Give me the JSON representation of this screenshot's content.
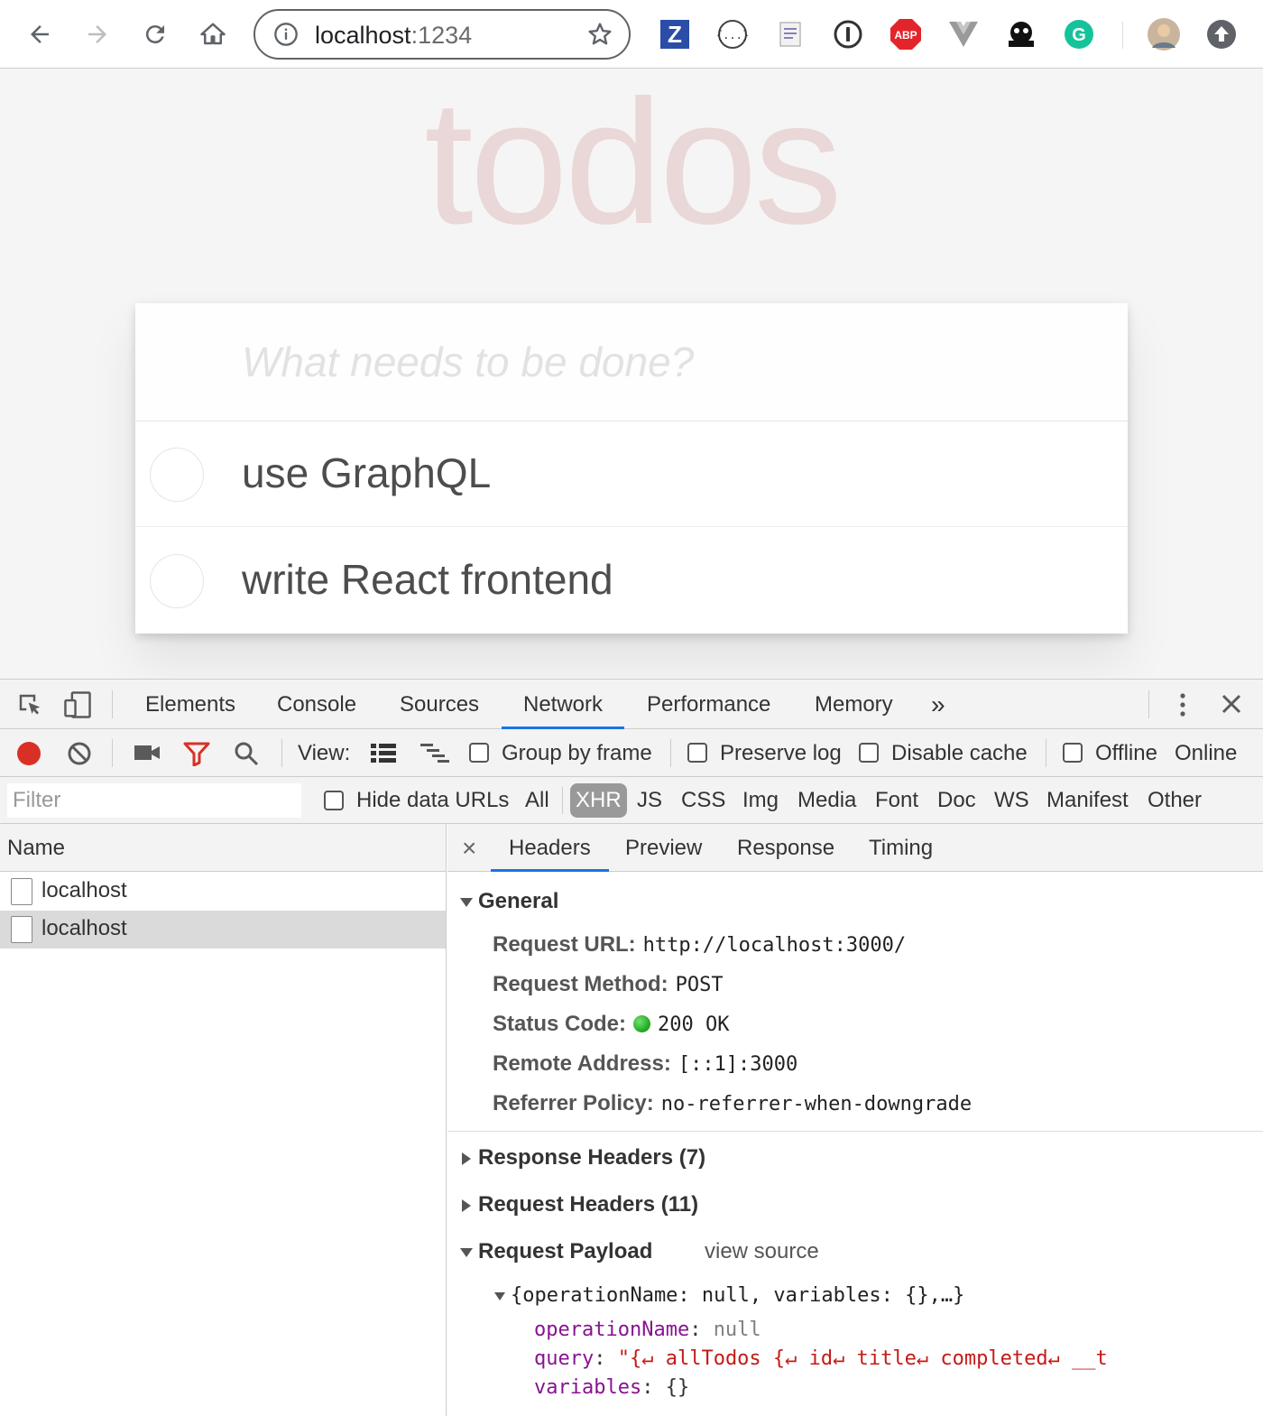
{
  "browser": {
    "url_host": "localhost",
    "url_port": ":1234",
    "extensions": [
      "zotero-icon",
      "json-formatter-icon",
      "notes-icon",
      "1password-icon",
      "adblock-plus-icon",
      "vue-devtools-icon",
      "kuker-icon",
      "grammarly-icon"
    ],
    "adblock_label": "ABP",
    "zotero_label": "Z"
  },
  "todo": {
    "title": "todos",
    "new_placeholder": "What needs to be done?",
    "items": [
      {
        "label": "use GraphQL",
        "completed": false
      },
      {
        "label": "write React frontend",
        "completed": false
      }
    ]
  },
  "devtools": {
    "tabs": [
      "Elements",
      "Console",
      "Sources",
      "Network",
      "Performance",
      "Memory"
    ],
    "active_tab": "Network",
    "more_tabs": "»",
    "toolbar": {
      "view_label": "View:",
      "group_by_frame": "Group by frame",
      "preserve_log": "Preserve log",
      "disable_cache": "Disable cache",
      "offline": "Offline",
      "online": "Online"
    },
    "filter": {
      "placeholder": "Filter",
      "hide_data_urls": "Hide data URLs",
      "types": [
        "All",
        "XHR",
        "JS",
        "CSS",
        "Img",
        "Media",
        "Font",
        "Doc",
        "WS",
        "Manifest",
        "Other"
      ],
      "active_type": "XHR"
    },
    "requests": {
      "column_name": "Name",
      "rows": [
        {
          "name": "localhost",
          "selected": false
        },
        {
          "name": "localhost",
          "selected": true
        }
      ]
    },
    "details": {
      "close": "×",
      "tabs": [
        "Headers",
        "Preview",
        "Response",
        "Timing"
      ],
      "active_tab": "Headers",
      "general": {
        "title": "General",
        "request_url_key": "Request URL:",
        "request_url": "http://localhost:3000/",
        "request_method_key": "Request Method:",
        "request_method": "POST",
        "status_code_key": "Status Code:",
        "status_code": "200 OK",
        "remote_address_key": "Remote Address:",
        "remote_address": "[::1]:3000",
        "referrer_policy_key": "Referrer Policy:",
        "referrer_policy": "no-referrer-when-downgrade"
      },
      "response_headers": "Response Headers (7)",
      "request_headers": "Request Headers (11)",
      "payload": {
        "title": "Request Payload",
        "view_source": "view source",
        "summary": "{operationName: null, variables: {},…}",
        "op_key": "operationName",
        "op_val": "null",
        "query_key": "query",
        "query_val": "\"{↵  allTodos {↵    id↵    title↵    completed↵    __t",
        "vars_key": "variables",
        "vars_val": "{}"
      }
    }
  },
  "colors": {
    "accent": "#1a73e8",
    "record": "#d93025",
    "filter_icon": "#d93025",
    "status_ok": "#1ea31e",
    "title": "rgba(175,47,47,0.15)"
  }
}
